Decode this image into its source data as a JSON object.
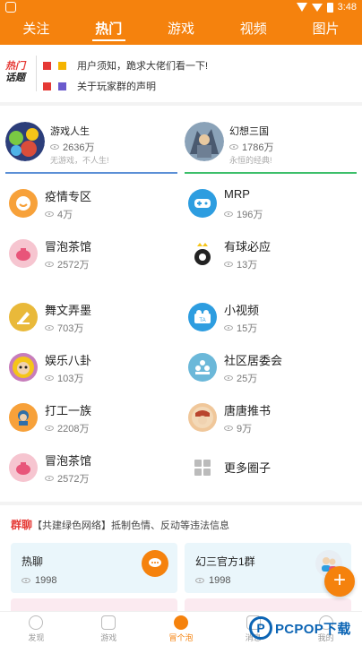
{
  "status": {
    "time": "3:48"
  },
  "top_tabs": [
    "关注",
    "热门",
    "游戏",
    "视频",
    "图片"
  ],
  "topics": {
    "logo_line1": "热门",
    "logo_line2": "话题",
    "items": [
      {
        "badge_text": "用户须知，跪求大佬们看一下!",
        "color": "#f5b400"
      },
      {
        "badge_text": "关于玩家群的声明",
        "color": "#6a5acd"
      }
    ]
  },
  "featured": [
    {
      "name": "游戏人生",
      "count": "2636万",
      "desc": "无游戏，不人生!",
      "accent": "#5b8fd6"
    },
    {
      "name": "幻想三国",
      "count": "1786万",
      "desc": "永恒的经典!",
      "accent": "#3cbf6a"
    }
  ],
  "categories": [
    {
      "title": "疫情专区",
      "count": "4万",
      "icon": "smile-icon",
      "bg": "#f7a13a"
    },
    {
      "title": "MRP",
      "count": "196万",
      "icon": "gamepad-icon",
      "bg": "#2d9de0"
    },
    {
      "title": "冒泡茶馆",
      "count": "2572万",
      "icon": "teapot-icon",
      "bg": "#f6c5d0"
    },
    {
      "title": "有球必应",
      "count": "13万",
      "icon": "football-icon",
      "bg": "#ffffff"
    },
    {
      "title": "舞文弄墨",
      "count": "703万",
      "icon": "pen-icon",
      "bg": "#e9b93a"
    },
    {
      "title": "小视频",
      "count": "15万",
      "icon": "video-icon",
      "bg": "#2d9de0"
    },
    {
      "title": "娱乐八卦",
      "count": "103万",
      "icon": "character-icon",
      "bg": "#c77dbb"
    },
    {
      "title": "社区居委会",
      "count": "25万",
      "icon": "community-icon",
      "bg": "#6bb8d9"
    },
    {
      "title": "打工一族",
      "count": "2208万",
      "icon": "worker-icon",
      "bg": "#f7a13a"
    },
    {
      "title": "唐唐推书",
      "count": "9万",
      "icon": "book-icon",
      "bg": "#f0c79a"
    },
    {
      "title": "冒泡茶馆",
      "count": "2572万",
      "icon": "teapot-icon",
      "bg": "#f6c5d0"
    },
    {
      "title": "更多圈子",
      "count": "",
      "icon": "grid-icon",
      "bg": "#ffffff"
    }
  ],
  "chats_header": {
    "title": "群聊",
    "notice": "【共建绿色网络】抵制色情、反动等违法信息"
  },
  "chats": [
    {
      "title": "热聊",
      "count": "1998"
    },
    {
      "title": "幻三官方1群",
      "count": "1998"
    }
  ],
  "bottom_nav": [
    "发现",
    "游戏",
    "冒个泡",
    "消息",
    "我的"
  ],
  "watermark": "PCPOP下载",
  "watermark_logo": "P",
  "fab_label": "+",
  "colors": {
    "accent": "#f5820d",
    "hot": "#e53935"
  }
}
